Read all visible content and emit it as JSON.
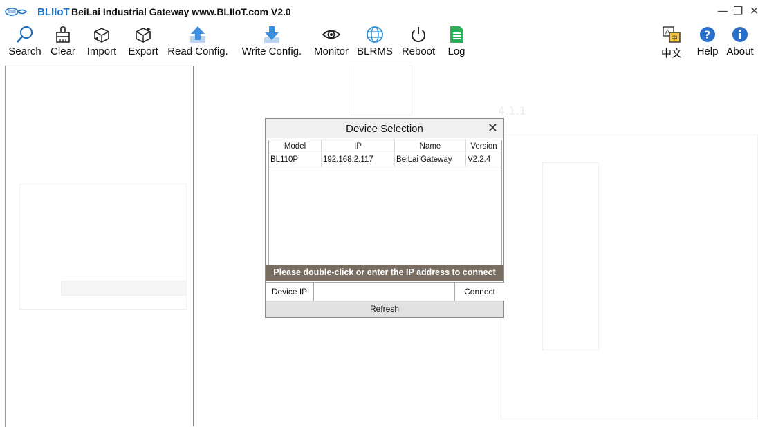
{
  "window": {
    "brand": "BLIIoT",
    "title_rest": "BeiLai Industrial Gateway www.BLIIoT.com V2.0",
    "minimize": "—",
    "maximize": "❐",
    "close": "✕"
  },
  "toolbar": {
    "items": [
      {
        "label": "Search",
        "icon": "search-icon"
      },
      {
        "label": "Clear",
        "icon": "broom-icon"
      },
      {
        "label": "Import",
        "icon": "import-box-icon"
      },
      {
        "label": "Export",
        "icon": "export-box-icon"
      },
      {
        "label": "Read Config.",
        "icon": "upload-arrow-icon"
      },
      {
        "label": "Write Config.",
        "icon": "download-arrow-icon"
      },
      {
        "label": "Monitor",
        "icon": "eye-icon"
      },
      {
        "label": "BLRMS",
        "icon": "globe-icon"
      },
      {
        "label": "Reboot",
        "icon": "power-icon"
      },
      {
        "label": "Log",
        "icon": "document-icon"
      }
    ],
    "right_items": [
      {
        "label": "中文",
        "icon": "translate-icon"
      },
      {
        "label": "Help",
        "icon": "help-icon"
      },
      {
        "label": "About",
        "icon": "info-icon"
      }
    ]
  },
  "background_ghost": {
    "heading": "4.1.1"
  },
  "dialog": {
    "title": "Device Selection",
    "close": "✕",
    "columns": [
      "Model",
      "IP",
      "Name",
      "Version"
    ],
    "rows": [
      {
        "model": "BL110P",
        "ip": "192.168.2.117",
        "name": "BeiLai Gateway",
        "version": "V2.2.4"
      }
    ],
    "prompt": "Please double-click or enter the IP address to connect",
    "ip_label": "Device IP",
    "ip_value": "",
    "connect_label": "Connect",
    "refresh_label": "Refresh"
  },
  "colors": {
    "brand": "#1a73c8",
    "prompt_bar": "#7a6e63",
    "refresh_bar": "#e2e2e2",
    "arrow_blue": "#3d8fe0",
    "log_green": "#2fae5a"
  }
}
